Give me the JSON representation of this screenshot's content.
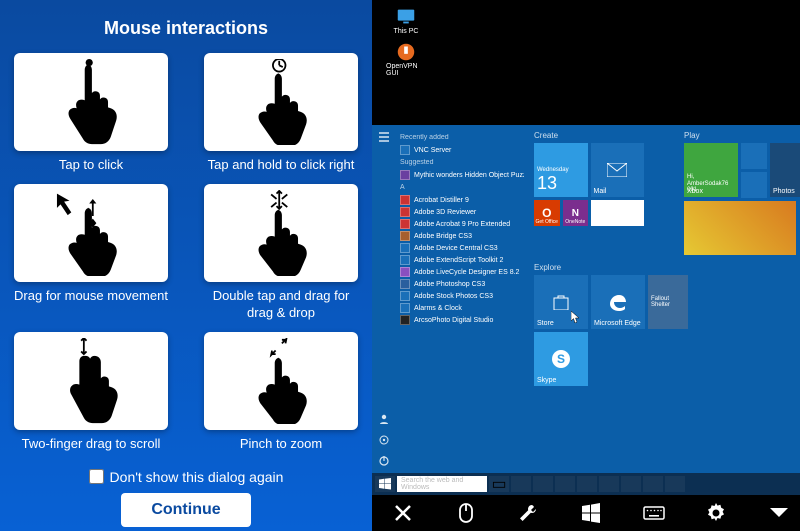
{
  "tutorial": {
    "title": "Mouse interactions",
    "gestures": [
      {
        "label": "Tap to click"
      },
      {
        "label": "Tap and hold to click right"
      },
      {
        "label": "Drag for mouse movement"
      },
      {
        "label": "Double tap and drag for drag & drop"
      },
      {
        "label": "Two-finger drag to scroll"
      },
      {
        "label": "Pinch to zoom"
      }
    ],
    "dont_show_label": "Don't show this dialog again",
    "continue_label": "Continue"
  },
  "remote": {
    "desktop_icons": [
      {
        "label": "This PC"
      },
      {
        "label": "OpenVPN GUI"
      }
    ],
    "start": {
      "recently_added_h": "Recently added",
      "recently_added": [
        "VNC Server"
      ],
      "suggested_h": "Suggested",
      "suggested": [
        "Mythic wonders Hidden Object Puzzle"
      ],
      "letter_a": "A",
      "apps": [
        "Acrobat Distiller 9",
        "Adobe 3D Reviewer",
        "Adobe Acrobat 9 Pro Extended",
        "Adobe Bridge CS3",
        "Adobe Device Central CS3",
        "Adobe ExtendScript Toolkit 2",
        "Adobe LiveCycle Designer ES 8.2",
        "Adobe Photoshop CS3",
        "Adobe Stock Photos CS3",
        "Alarms & Clock",
        "ArcsoPhoto Digital Studio"
      ],
      "groups": {
        "create": "Create",
        "play": "Play",
        "explore": "Explore"
      },
      "tiles": {
        "calendar_day": "Wednesday",
        "calendar_date": "13",
        "mail": "Mail",
        "get_office": "Get Office",
        "onenote": "OneNote",
        "greeting": "Hi, AmberSodak76 091",
        "xbox": "Xbox",
        "photos": "Photos",
        "store": "Store",
        "edge": "Microsoft Edge",
        "fallout": "Fallout Shelter",
        "skype": "Skype"
      }
    },
    "taskbar": {
      "search_placeholder": "Search the web and Windows"
    },
    "toolbar": {
      "items": [
        "close",
        "mouse",
        "wrench",
        "windows",
        "keyboard",
        "gear",
        "collapse"
      ]
    }
  }
}
